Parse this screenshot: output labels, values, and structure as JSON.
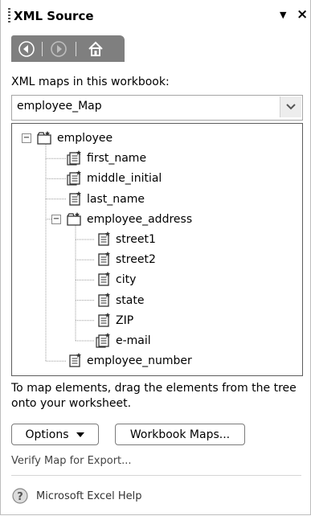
{
  "panel": {
    "title": "XML Source"
  },
  "maps": {
    "label": "XML maps in this workbook:",
    "selected": "employee_Map"
  },
  "tree": {
    "items": [
      "employee",
      "first_name",
      "middle_initial",
      "last_name",
      "employee_address",
      "street1",
      "street2",
      "city",
      "state",
      "ZIP",
      "e-mail",
      "employee_number"
    ]
  },
  "hint": "To map elements, drag the elements from the tree onto your worksheet.",
  "buttons": {
    "options": "Options",
    "workbook_maps": "Workbook Maps..."
  },
  "links": {
    "verify": "Verify Map for Export...",
    "help": "Microsoft Excel Help"
  }
}
